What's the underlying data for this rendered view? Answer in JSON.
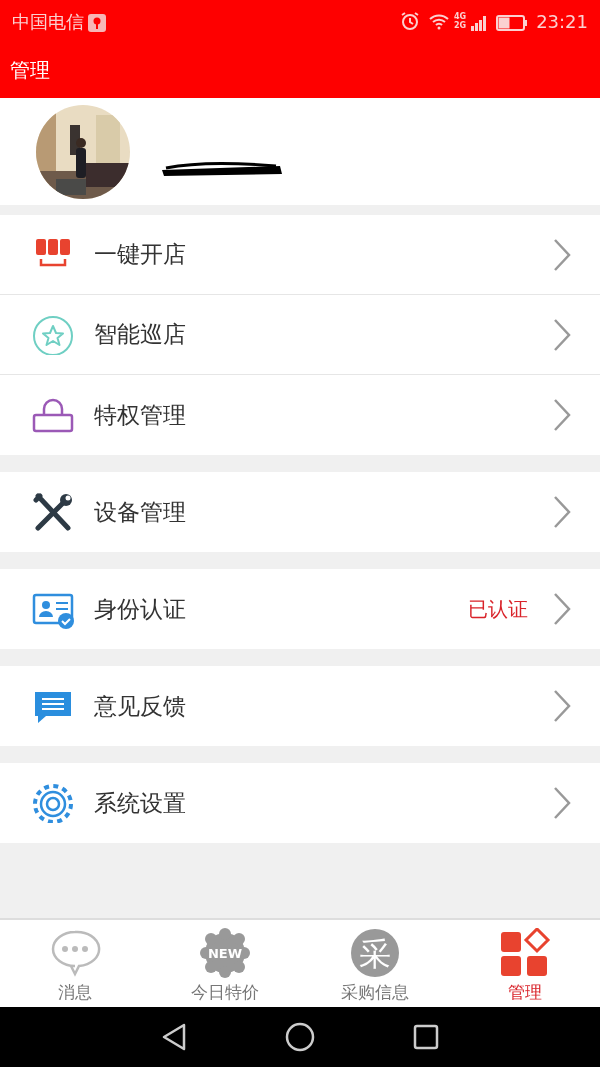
{
  "status_bar": {
    "carrier": "中国电信",
    "time": "23:21",
    "network_top": "4G",
    "network_bottom": "2G"
  },
  "app_bar": {
    "title": "管理"
  },
  "profile": {
    "phone_redacted": true
  },
  "sections": [
    {
      "items": [
        {
          "kind": "shop",
          "label": "一键开店"
        },
        {
          "kind": "star",
          "label": "智能巡店"
        },
        {
          "kind": "lock",
          "label": "特权管理"
        }
      ]
    },
    {
      "items": [
        {
          "kind": "tools",
          "label": "设备管理"
        }
      ]
    },
    {
      "items": [
        {
          "kind": "idcard",
          "label": "身份认证",
          "status": "已认证"
        }
      ]
    },
    {
      "items": [
        {
          "kind": "chat",
          "label": "意见反馈"
        }
      ]
    },
    {
      "items": [
        {
          "kind": "gear",
          "label": "系统设置"
        }
      ]
    }
  ],
  "tabs": [
    {
      "kind": "message",
      "label": "消息",
      "selected": false
    },
    {
      "kind": "new",
      "label": "今日特价",
      "badge": "NEW",
      "selected": false
    },
    {
      "kind": "purchase",
      "label": "采购信息",
      "glyph": "采",
      "selected": false
    },
    {
      "kind": "manage",
      "label": "管理",
      "selected": true
    }
  ]
}
